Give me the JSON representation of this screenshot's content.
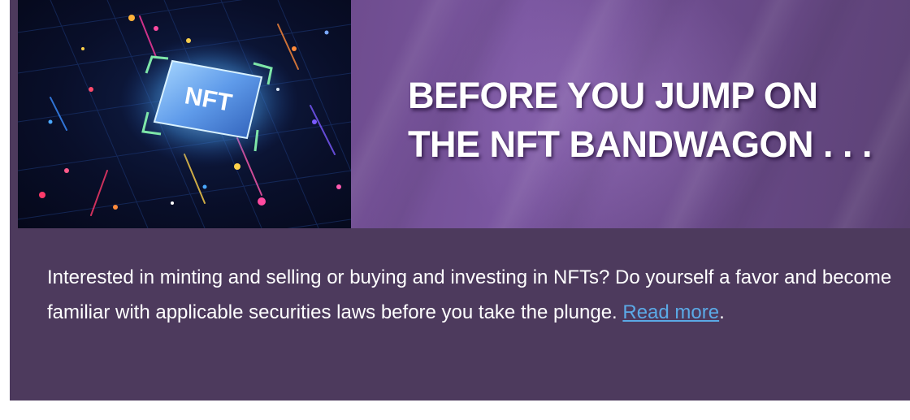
{
  "banner": {
    "image_label": "NFT",
    "headline_line1": "BEFORE YOU JUMP ON",
    "headline_line2": "THE NFT BANDWAGON . . ."
  },
  "article": {
    "text_before_link": "Interested in minting and selling or buying and investing in NFTs? Do yourself a favor and become familiar with applicable securities laws before you take the plunge. ",
    "link_label": "Read more",
    "text_after_link": "."
  },
  "colors": {
    "card_background": "#4d3a5d",
    "link": "#5ba9e6",
    "headline": "#ffffff"
  }
}
